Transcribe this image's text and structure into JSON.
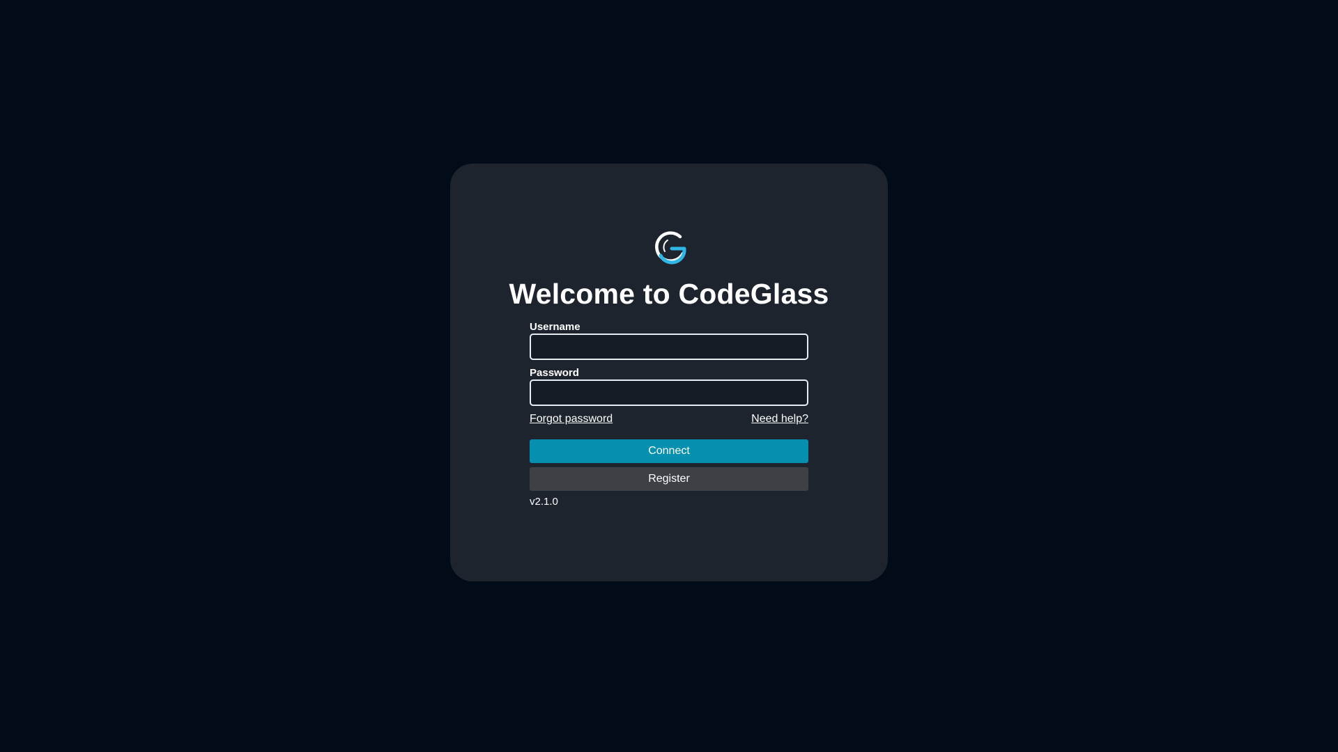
{
  "app": {
    "title": "Welcome to CodeGlass",
    "logo_icon": "codeglass-logo-icon",
    "accent_color": "#0590b0",
    "logo_accent_color": "#2fb6e4"
  },
  "form": {
    "username_label": "Username",
    "username_value": "",
    "username_placeholder": "",
    "password_label": "Password",
    "password_value": "",
    "password_placeholder": "",
    "forgot_password": "Forgot password",
    "need_help": "Need help?",
    "connect_label": "Connect",
    "register_label": "Register"
  },
  "footer": {
    "version": "v2.1.0"
  }
}
